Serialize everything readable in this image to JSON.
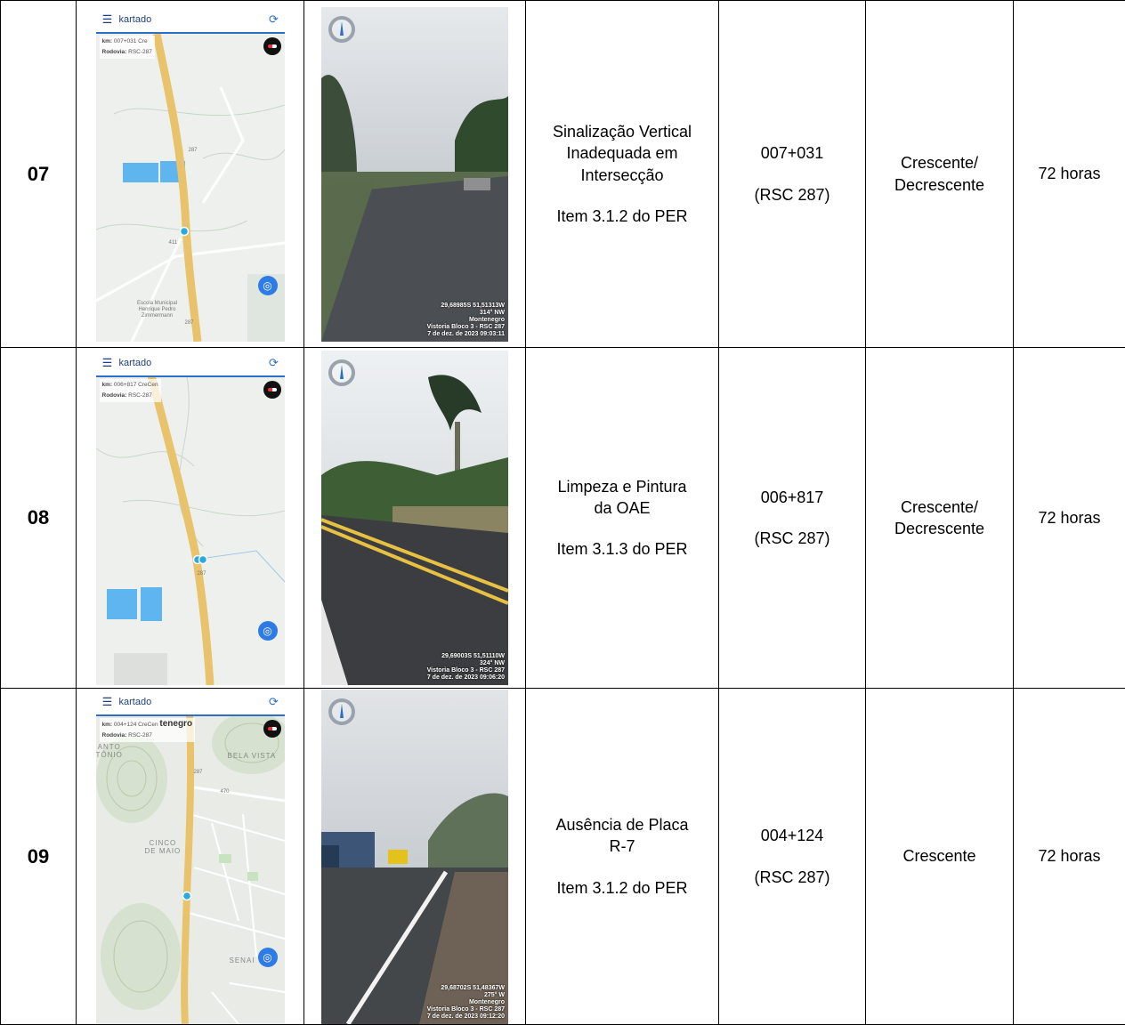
{
  "app": {
    "name": "kartado"
  },
  "rows": [
    {
      "number": "07",
      "map": {
        "info_km_label": "km:",
        "info_km": "007+031 Cre",
        "info_rodovia_label": "Rodovia:",
        "info_rodovia": "RSC-287",
        "road_number_top": "287",
        "road_number_bottom": "287",
        "side_road": "411",
        "school_label": "Escola Municipal Henrique Pedro Zimmermann"
      },
      "photo": {
        "overlay": "29,68985S 51,51313W\n314° NW\nMontenegro\nVistoria Bloco 3 - RSC 287\n7 de dez. de 2023 09:03:11"
      },
      "description_lines": [
        "Sinalização Vertical",
        "Inadequada em",
        "Intersecção"
      ],
      "reference": "Item 3.1.2 do PER",
      "km": "007+031",
      "road": "(RSC 287)",
      "direction_lines": [
        "Crescente/",
        "Decrescente"
      ],
      "deadline": "72 horas"
    },
    {
      "number": "08",
      "map": {
        "info_km_label": "km:",
        "info_km": "006+817 CreCen",
        "info_rodovia_label": "Rodovia:",
        "info_rodovia": "RSC-287",
        "road_number_top": "287"
      },
      "photo": {
        "overlay": "29,69003S 51,51110W\n324° NW\nVistoria Bloco 3 - RSC 287\n7 de dez. de 2023 09:06:20"
      },
      "description_lines": [
        "Limpeza e Pintura",
        "da OAE"
      ],
      "reference": "Item 3.1.3 do PER",
      "km": "006+817",
      "road": "(RSC 287)",
      "direction_lines": [
        "Crescente/",
        "Decrescente"
      ],
      "deadline": "72 horas"
    },
    {
      "number": "09",
      "map": {
        "info_km_label": "km:",
        "info_km": "004+124 CreCen",
        "info_rodovia_label": "Rodovia:",
        "info_rodovia": "RSC-287",
        "city_label": "tenegro",
        "place_santo": "ANTO\nTÔNIO",
        "place_bela_vista": "BELA VISTA",
        "place_cinco": "CINCO\nDE MAIO",
        "place_senai": "SENAI",
        "road_number": "287",
        "side_road": "470"
      },
      "photo": {
        "overlay": "29,68702S 51,48367W\n275° W\nMontenegro\nVistoria Bloco 3 - RSC 287\n7 de dez. de 2023 09:12:20"
      },
      "description_lines": [
        "Ausência de Placa",
        "R-7"
      ],
      "reference": "Item 3.1.2 do PER",
      "km": "004+124",
      "road": "(RSC 287)",
      "direction_lines": [
        "Crescente"
      ],
      "deadline": "72 horas"
    }
  ],
  "colors": {
    "road": "#e8c36b",
    "map_bg": "#eef0ee",
    "lake": "#5fb6ee",
    "accent": "#2b6fc9",
    "locate": "#2f7be6"
  }
}
